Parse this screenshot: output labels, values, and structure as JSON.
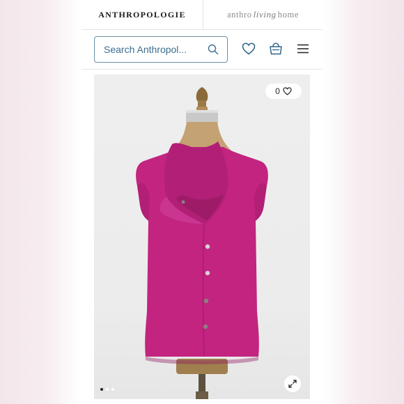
{
  "brands": {
    "primary": "ANTHROPOLOGIE",
    "secondary_a": "anthro",
    "secondary_script": "living",
    "secondary_b": "home"
  },
  "header": {
    "search_placeholder": "Search Anthropol...",
    "icons": [
      "heart-icon",
      "basket-icon",
      "menu-icon"
    ]
  },
  "product": {
    "favorite_count": "0",
    "image_description_color": "#c2247f",
    "carousel": {
      "total": 3,
      "active": 1
    }
  },
  "colors": {
    "accent": "#3b6e8f",
    "garment": "#c2247f"
  }
}
